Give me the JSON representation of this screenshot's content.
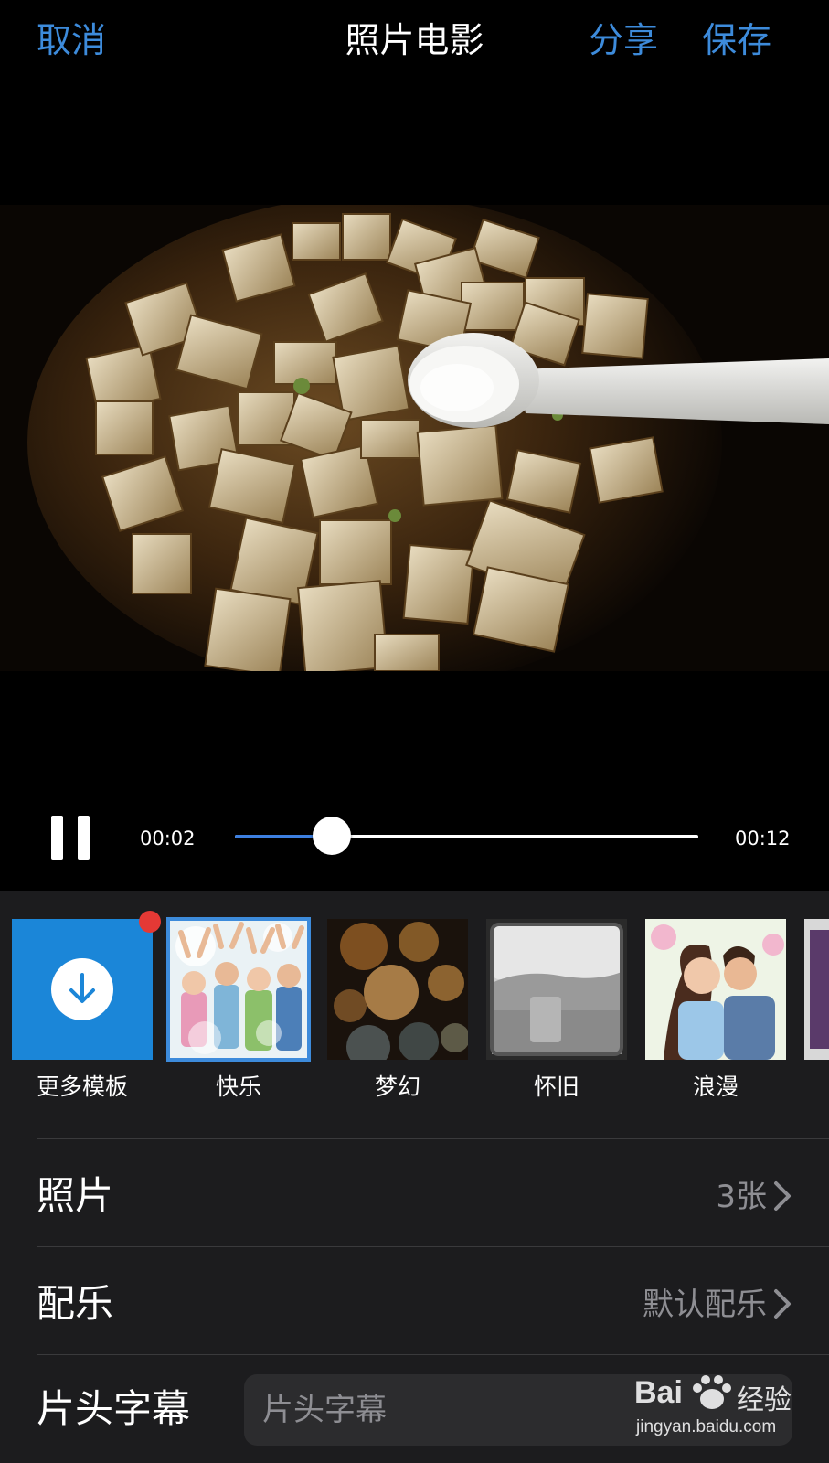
{
  "nav": {
    "cancel": "取消",
    "title": "照片电影",
    "share": "分享",
    "save": "保存"
  },
  "player": {
    "current_time": "00:02",
    "total_time": "00:12",
    "progress": 0.21,
    "state": "playing"
  },
  "templates": [
    {
      "label": "更多模板",
      "icon": "download-icon",
      "badge": true
    },
    {
      "label": "快乐",
      "selected": true
    },
    {
      "label": "梦幻"
    },
    {
      "label": "怀旧"
    },
    {
      "label": "浪漫"
    }
  ],
  "settings": {
    "photos": {
      "label": "照片",
      "value": "3张"
    },
    "music": {
      "label": "配乐",
      "value": "默认配乐"
    },
    "title_caption": {
      "label": "片头字幕",
      "placeholder": "片头字幕"
    }
  },
  "watermark": {
    "brand": "Bai",
    "brand2": "经验",
    "url": "jingyan.baidu.com"
  },
  "colors": {
    "accent": "#3d8bdb",
    "badge": "#e53935",
    "panel": "#1c1c1e"
  }
}
